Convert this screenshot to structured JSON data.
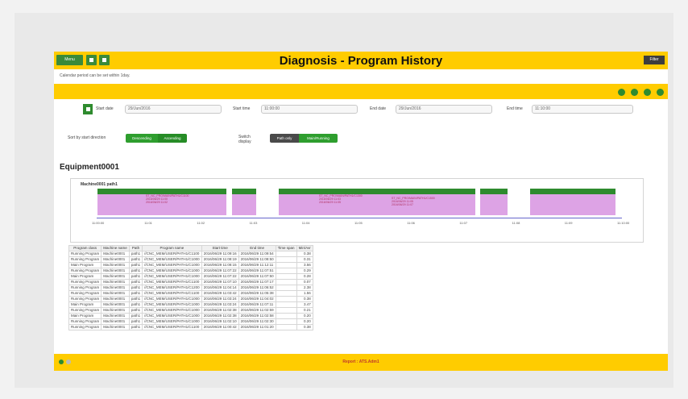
{
  "header": {
    "menu_label": "Menu",
    "title": "Diagnosis - Program History",
    "filter_label": "Filter"
  },
  "note": "Calendar period can be set within 1day.",
  "filters": {
    "start_date_label": "Start date",
    "start_date_value": "29/Jun/2016",
    "start_time_label": "Start time",
    "start_time_value": "11:00:00",
    "end_date_label": "End date",
    "end_date_value": "29/Jun/2016",
    "end_time_label": "End time",
    "end_time_value": "11:10:00",
    "sort_label": "Sort by start direction",
    "sort_options": [
      "Descending",
      "Ascending"
    ],
    "switch_label": "Switch display",
    "switch_options": [
      "Path only",
      "Main/Running"
    ]
  },
  "equipment": {
    "name": "Equipment0001",
    "chart_title": "Machine0001 path1",
    "axis_ticks": [
      "11:00:00",
      "11:01",
      "11:02",
      "11:03",
      "11:04",
      "11:05",
      "11:06",
      "11:07",
      "11:08",
      "11:09",
      "11:10:00"
    ],
    "segment_texts": [
      [
        "ST_NC_PRO/MAIN/PATH1/C1100",
        "2016/06/29 11:00",
        "2016/06/29 11:02"
      ],
      [
        "ST_NC_PRO/MAIN/PATH1/C1300",
        "2016/06/29 11:03",
        "2016/06/29 11:05"
      ],
      [
        "ST_NC_PRO/MAIN/PATH1/C1500",
        "2016/06/29 11:05",
        "2016/06/29 11:07"
      ]
    ]
  },
  "table": {
    "headers": [
      "Program class",
      "Machine name",
      "Path",
      "Program name",
      "Start time",
      "End time",
      "Time span",
      "Min/Avr"
    ],
    "rows": [
      [
        "Running Program",
        "Machine0001",
        "path1",
        "//CNC_MEM/USER/PATH1/C1100",
        "2016/06/29 11:09:16",
        "2016/06/29 11:09:54",
        "",
        "0.38"
      ],
      [
        "Running Program",
        "Machine0001",
        "path1",
        "//CNC_MEM/USER/PATH1/C1000",
        "2016/06/29 11:08:19",
        "2016/06/29 11:08:50",
        "",
        "0.31"
      ],
      [
        "Main Program",
        "Machine0001",
        "path1",
        "//CNC_MEM/USER/PATH1/C1000",
        "2016/06/29 11:08:15",
        "2016/06/29 11:12:11",
        "",
        "3.56"
      ],
      [
        "Running Program",
        "Machine0001",
        "path1",
        "//CNC_MEM/USER/PATH1/C1000",
        "2016/06/29 11:07:22",
        "2016/06/29 11:07:51",
        "",
        "0.29"
      ],
      [
        "Main Program",
        "Machine0001",
        "path1",
        "//CNC_MEM/USER/PATH1/C1000",
        "2016/06/29 11:07:22",
        "2016/06/29 11:07:50",
        "",
        "0.28"
      ],
      [
        "Running Program",
        "Machine0001",
        "path1",
        "//CNC_MEM/USER/PATH1/C1100",
        "2016/06/29 11:07:10",
        "2016/06/29 11:07:17",
        "",
        "0.07"
      ],
      [
        "Running Program",
        "Machine0001",
        "path1",
        "//CNC_MEM/USER/PATH1/C1200",
        "2016/06/29 11:04:14",
        "2016/06/29 11:06:52",
        "",
        "2.38"
      ],
      [
        "Running Program",
        "Machine0001",
        "path1",
        "//CNC_MEM/USER/PATH1/C1100",
        "2016/06/29 11:03:42",
        "2016/06/29 11:05:38",
        "",
        "1.56"
      ],
      [
        "Running Program",
        "Machine0001",
        "path1",
        "//CNC_MEM/USER/PATH1/C1000",
        "2016/06/29 11:03:24",
        "2016/06/29 11:04:02",
        "",
        "0.38"
      ],
      [
        "Main Program",
        "Machine0001",
        "path1",
        "//CNC_MEM/USER/PATH1/C1000",
        "2016/06/29 11:03:24",
        "2016/06/29 11:07:11",
        "",
        "3.47"
      ],
      [
        "Running Program",
        "Machine0001",
        "path1",
        "//CNC_MEM/USER/PATH1/C1000",
        "2016/06/29 11:02:38",
        "2016/06/29 11:02:59",
        "",
        "0.21"
      ],
      [
        "Main Program",
        "Machine0001",
        "path1",
        "//CNC_MEM/USER/PATH1/C1000",
        "2016/06/29 11:02:38",
        "2016/06/29 11:02:58",
        "",
        "0.20"
      ],
      [
        "Running Program",
        "Machine0001",
        "path1",
        "//CNC_MEM/USER/PATH1/C1000",
        "2016/06/29 11:02:10",
        "2016/06/29 11:02:30",
        "",
        "0.20"
      ],
      [
        "Running Program",
        "Machine0001",
        "path1",
        "//CNC_MEM/USER/PATH1/C1100",
        "2016/06/29 11:00:42",
        "2016/06/29 11:01:20",
        "",
        "0.38"
      ]
    ]
  },
  "footer": {
    "text": "Report : ATS.Adm1"
  }
}
